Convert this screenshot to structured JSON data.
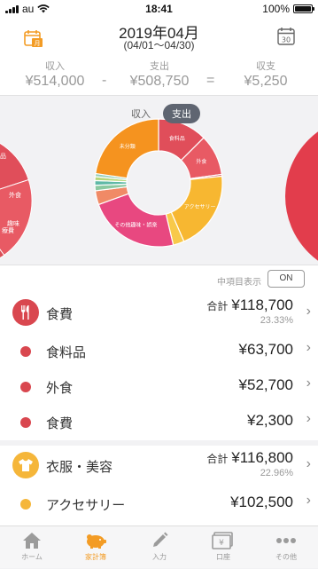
{
  "status": {
    "carrier": "au",
    "time": "18:41",
    "battery": "100%"
  },
  "header": {
    "title": "2019年04月",
    "subtitle": "(04/01〜04/30)"
  },
  "summary": {
    "income_label": "収入",
    "income_value": "¥514,000",
    "minus": "-",
    "expense_label": "支出",
    "expense_value": "¥508,750",
    "equals": "=",
    "net_label": "収支",
    "net_value": "¥5,250"
  },
  "toggle": {
    "income": "収入",
    "expense": "支出",
    "selected": "支出"
  },
  "chart_data": {
    "type": "pie",
    "slices": [
      {
        "label": "食料品",
        "value": 63700,
        "color": "#e04e5a"
      },
      {
        "label": "外食",
        "value": 52700,
        "color": "#e85a64"
      },
      {
        "label": "",
        "value": 2300,
        "color": "#d94f57"
      },
      {
        "label": "アクセサリー",
        "value": 102500,
        "color": "#f7b731"
      },
      {
        "label": "",
        "value": 14300,
        "color": "#f8c94a"
      },
      {
        "label": "その他趣味・娯楽",
        "value": 118000,
        "color": "#e84880"
      },
      {
        "label": "",
        "value": 18000,
        "color": "#f08a66"
      },
      {
        "label": "",
        "value": 7000,
        "color": "#8bc9a0"
      },
      {
        "label": "",
        "value": 6000,
        "color": "#5fb9a6"
      },
      {
        "label": "",
        "value": 5000,
        "color": "#b6d77a"
      },
      {
        "label": "",
        "value": 4000,
        "color": "#9ad0bb"
      },
      {
        "label": "未分類",
        "value": 115250,
        "color": "#f5931f"
      }
    ],
    "left_labels": [
      "品",
      "外食",
      "趣味",
      "療費"
    ]
  },
  "option": {
    "label": "中項目表示",
    "button": "ON"
  },
  "list": {
    "total_label": "合計",
    "categories": [
      {
        "name": "食費",
        "total": "¥118,700",
        "percent": "23.33%",
        "color": "#d9474f",
        "items": [
          {
            "name": "食料品",
            "amount": "¥63,700"
          },
          {
            "name": "外食",
            "amount": "¥52,700"
          },
          {
            "name": "食費",
            "amount": "¥2,300"
          }
        ]
      },
      {
        "name": "衣服・美容",
        "total": "¥116,800",
        "percent": "22.96%",
        "color": "#f5b63a",
        "items": [
          {
            "name": "アクセサリー",
            "amount": "¥102,500"
          }
        ]
      }
    ]
  },
  "tabs": [
    {
      "label": "ホーム",
      "icon": "home-icon"
    },
    {
      "label": "家計簿",
      "icon": "piggy-bank-icon"
    },
    {
      "label": "入力",
      "icon": "pencil-icon"
    },
    {
      "label": "口座",
      "icon": "yen-card-icon"
    },
    {
      "label": "その他",
      "icon": "more-dots-icon"
    }
  ],
  "colors": {
    "accent": "#f39c25",
    "food": "#d9474f",
    "clothes": "#f5b63a"
  }
}
